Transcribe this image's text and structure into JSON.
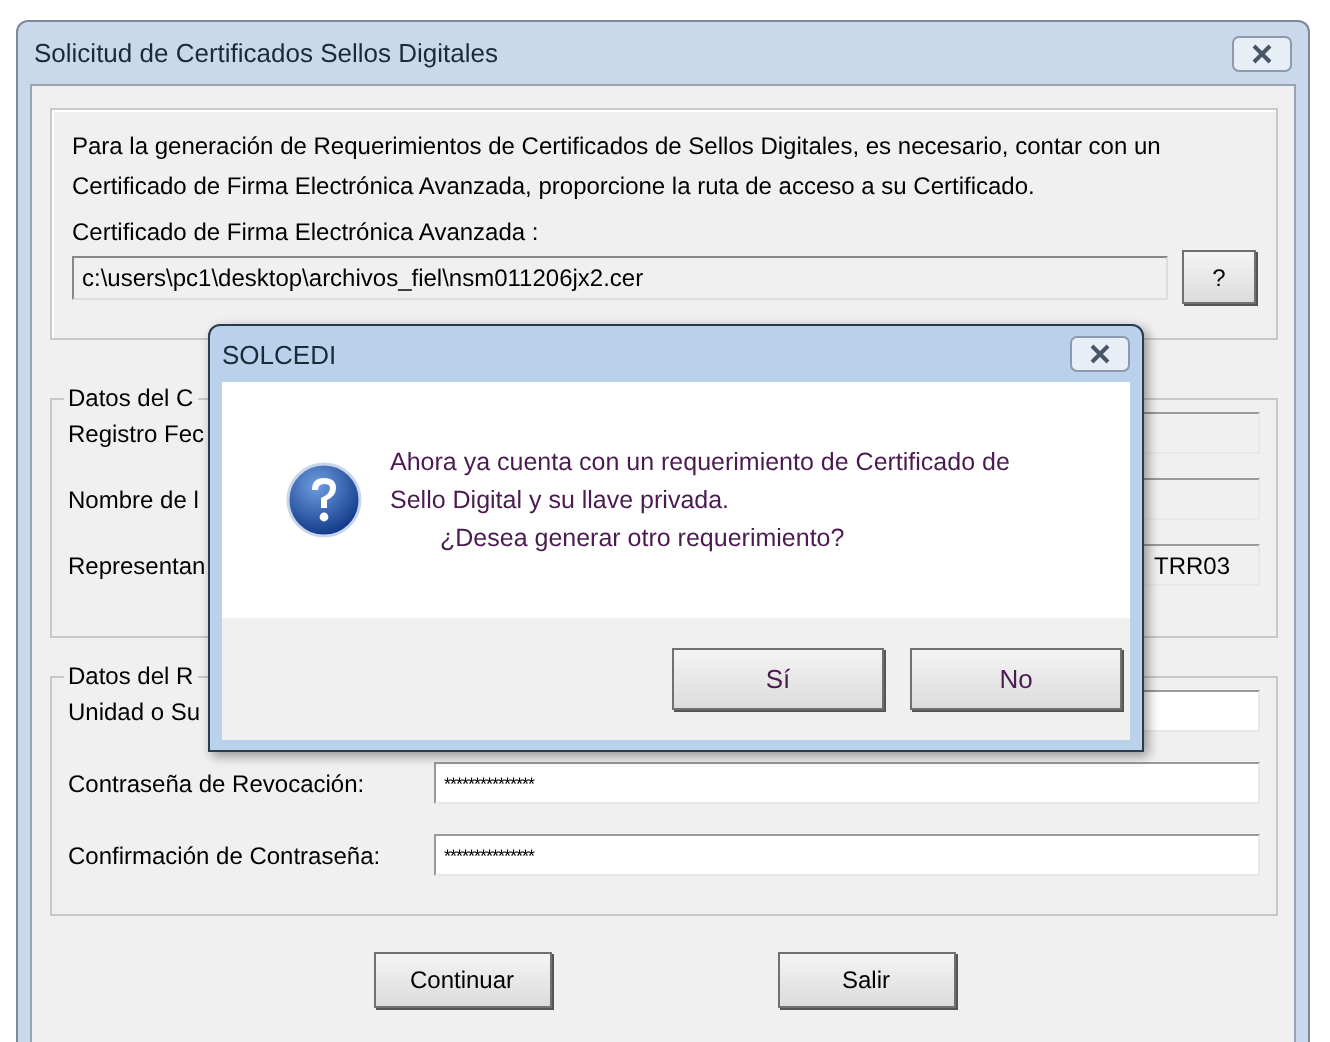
{
  "window": {
    "title": "Solicitud de Certificados Sellos Digitales"
  },
  "intro": {
    "text": "Para la generación de Requerimientos de Certificados de Sellos Digitales, es necesario, contar con un Certificado de Firma Electrónica Avanzada, proporcione la ruta de acceso a su Certificado.",
    "certificate_label": "Certificado de Firma Electrónica Avanzada :",
    "certificate_path": "c:\\users\\pc1\\desktop\\archivos_fiel\\nsm011206jx2.cer",
    "help_button": "?"
  },
  "groups": [
    {
      "legend": "Datos del C",
      "fields": [
        {
          "label": "Registro Fec"
        },
        {
          "label": "Nombre de l"
        },
        {
          "label": "Representan",
          "value": "TRR03"
        }
      ]
    },
    {
      "legend": "Datos del R",
      "fields": [
        {
          "label": "Unidad o Su"
        },
        {
          "label": "Contraseña de Revocación:",
          "value": "***************"
        },
        {
          "label": "Confirmación de Contraseña:",
          "value": "***************"
        }
      ]
    }
  ],
  "buttons": [
    "Continuar",
    "Salir"
  ],
  "dialog": {
    "title": "SOLCEDI",
    "message": "Ahora ya cuenta con un requerimiento de Certificado de Sello Digital y su llave privada.",
    "question": "¿Desea generar otro requerimiento?",
    "buttons": [
      "Sí",
      "No"
    ]
  }
}
